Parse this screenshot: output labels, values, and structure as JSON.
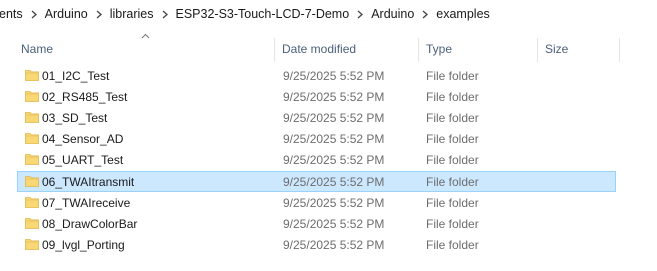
{
  "breadcrumb": {
    "items": [
      "ents",
      "Arduino",
      "libraries",
      "ESP32-S3-Touch-LCD-7-Demo",
      "Arduino",
      "examples"
    ]
  },
  "columns": {
    "name": "Name",
    "date": "Date modified",
    "type": "Type",
    "size": "Size"
  },
  "sort": {
    "column": "Name",
    "icon": "sort-up-chevron-icon"
  },
  "files": [
    {
      "name": "01_I2C_Test",
      "date": "9/25/2025 5:52 PM",
      "type": "File folder",
      "size": ""
    },
    {
      "name": "02_RS485_Test",
      "date": "9/25/2025 5:52 PM",
      "type": "File folder",
      "size": ""
    },
    {
      "name": "03_SD_Test",
      "date": "9/25/2025 5:52 PM",
      "type": "File folder",
      "size": ""
    },
    {
      "name": "04_Sensor_AD",
      "date": "9/25/2025 5:52 PM",
      "type": "File folder",
      "size": ""
    },
    {
      "name": "05_UART_Test",
      "date": "9/25/2025 5:52 PM",
      "type": "File folder",
      "size": ""
    },
    {
      "name": "06_TWAItransmit",
      "date": "9/25/2025 5:52 PM",
      "type": "File folder",
      "size": "",
      "selected": true
    },
    {
      "name": "07_TWAIreceive",
      "date": "9/25/2025 5:52 PM",
      "type": "File folder",
      "size": ""
    },
    {
      "name": "08_DrawColorBar",
      "date": "9/25/2025 5:52 PM",
      "type": "File folder",
      "size": ""
    },
    {
      "name": "09_lvgl_Porting",
      "date": "9/25/2025 5:52 PM",
      "type": "File folder",
      "size": ""
    }
  ],
  "colors": {
    "folder": "#f8d775",
    "folder_dark": "#e0b64a",
    "selection_bg": "#cce8ff",
    "selection_border": "#99d1ff",
    "header_text": "#4c607a"
  }
}
